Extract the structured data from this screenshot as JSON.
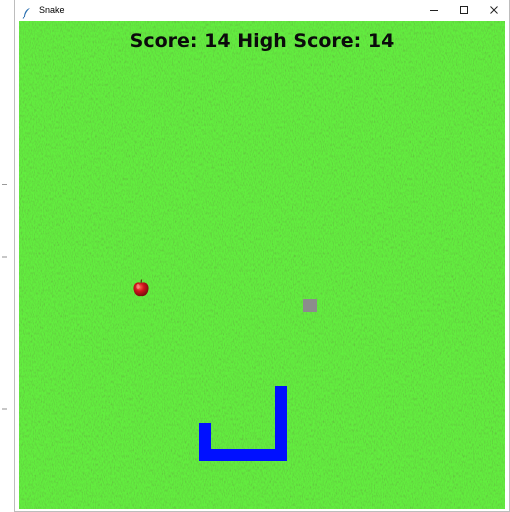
{
  "window": {
    "title": "Snake"
  },
  "titlebar_icons": {
    "app": "feather-icon",
    "minimize": "minimize-icon",
    "maximize": "maximize-icon",
    "close": "close-icon"
  },
  "hud": {
    "score_label": "Score:",
    "score": 14,
    "high_score_label": "High Score:",
    "high_score": 14
  },
  "game": {
    "food": "red-apple",
    "obstacle": "gray-block",
    "snake_color": "#0010ff",
    "background": "grass"
  },
  "colors": {
    "grass": "#3d8d1d",
    "snake": "#0010ff",
    "obstacle": "#8c8c8c",
    "apple": "#c8101a"
  }
}
